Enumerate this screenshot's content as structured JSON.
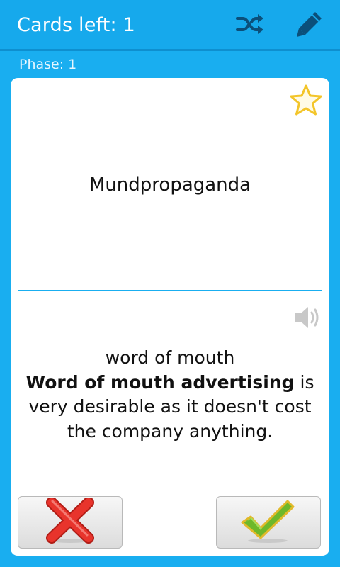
{
  "header": {
    "cards_left": "Cards left: 1",
    "icons": [
      "shuffle-icon",
      "pencil-icon"
    ]
  },
  "phase_text": "Phase: 1",
  "card": {
    "front": "Mundpropaganda",
    "back_translation": "word of mouth",
    "example_bold": "Word of mouth advertising",
    "example_rest": " is very desirable as it doesn't cost the company anything.",
    "icons": [
      "star-outline-icon",
      "speaker-icon"
    ]
  },
  "buttons": {
    "wrong_icon": "red-x-icon",
    "right_icon": "green-check-icon"
  },
  "colors": {
    "background": "#19aef0",
    "accent_blue": "#19aef0",
    "star": "#f3c52a",
    "wrong": "#e8342c",
    "right": "#6eb82a"
  }
}
